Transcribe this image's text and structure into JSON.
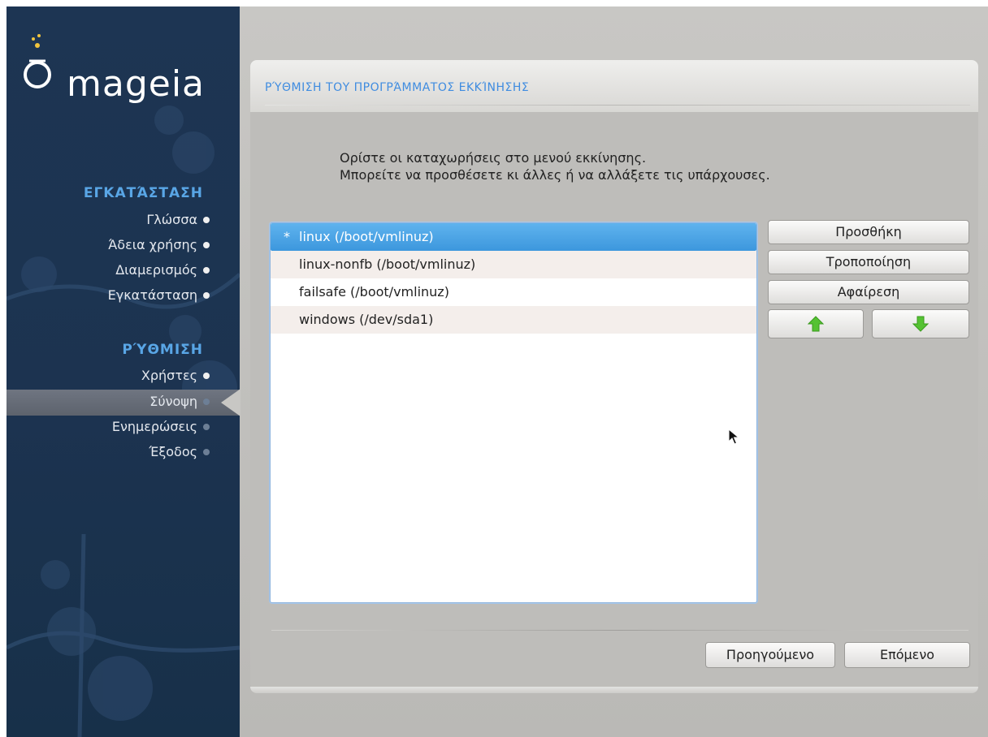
{
  "logo": {
    "text": "mageia"
  },
  "sidebar": {
    "installation": {
      "title": "ΕΓΚΑΤΆΣΤΑΣΗ",
      "steps": [
        {
          "label": "Γλώσσα",
          "state": "done"
        },
        {
          "label": "Άδεια χρήσης",
          "state": "done"
        },
        {
          "label": "Διαμερισμός",
          "state": "done"
        },
        {
          "label": "Εγκατάσταση",
          "state": "done"
        }
      ]
    },
    "configuration": {
      "title": "ΡΎΘΜΙΣΗ",
      "steps": [
        {
          "label": "Χρήστες",
          "state": "done"
        },
        {
          "label": "Σύνοψη",
          "state": "current"
        },
        {
          "label": "Ενημερώσεις",
          "state": "pending"
        },
        {
          "label": "Έξοδος",
          "state": "pending"
        }
      ]
    }
  },
  "page": {
    "title": "ΡΎΘΜΙΣΗ ΤΟΥ ΠΡΟΓΡΆΜΜΑΤΟΣ ΕΚΚΊΝΗΣΗΣ",
    "instructions": [
      "Ορίστε οι καταχωρήσεις στο μενού εκκίνησης.",
      "Μπορείτε να προσθέσετε κι άλλες ή να αλλάξετε τις υπάρχουσες."
    ],
    "entries": [
      {
        "marker": "*",
        "label": "linux (/boot/vmlinuz)",
        "selected": true
      },
      {
        "marker": "",
        "label": "linux-nonfb (/boot/vmlinuz)",
        "selected": false
      },
      {
        "marker": "",
        "label": "failsafe (/boot/vmlinuz)",
        "selected": false
      },
      {
        "marker": "",
        "label": "windows (/dev/sda1)",
        "selected": false
      }
    ],
    "buttons": {
      "add": "Προσθήκη",
      "modify": "Τροποποίηση",
      "remove": "Αφαίρεση",
      "move_up_icon": "green-arrow-up-icon",
      "move_down_icon": "green-arrow-down-icon"
    },
    "nav": {
      "previous": "Προηγούμενο",
      "next": "Επόμενο"
    }
  },
  "colors": {
    "sidebar_bg": "#1d3553",
    "section_title": "#59a6e6",
    "page_title": "#3f8ce0",
    "selection": "#3c97dd",
    "arrow_green": "#4cbb2f"
  }
}
